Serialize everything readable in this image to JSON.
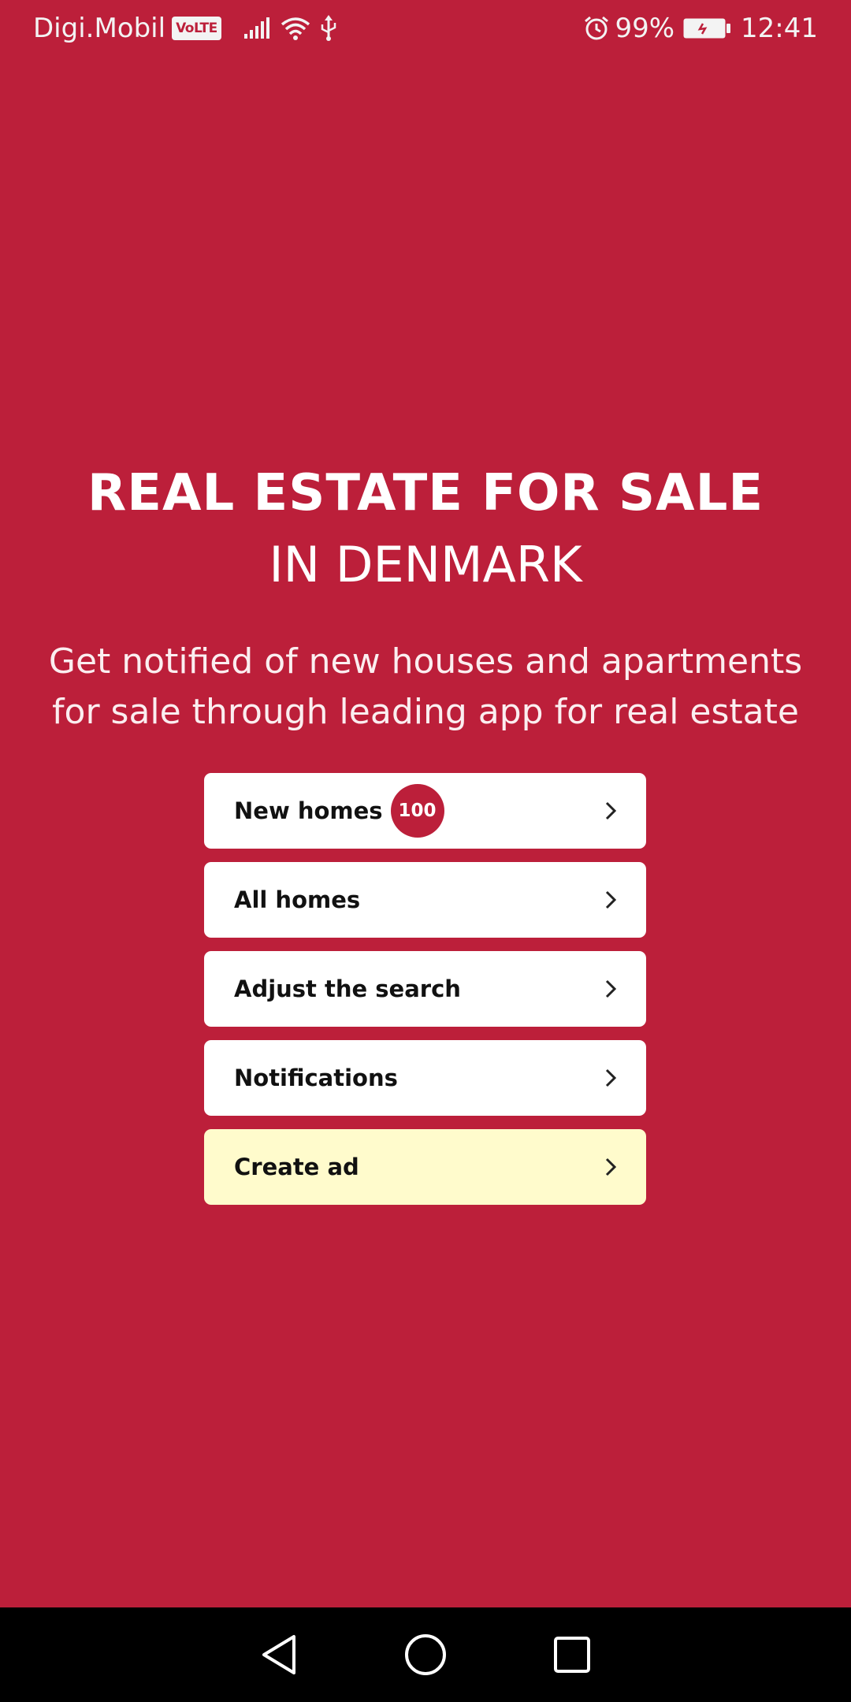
{
  "status_bar": {
    "carrier": "Digi.Mobil",
    "volte": "VoLTE",
    "battery": "99%",
    "time": "12:41",
    "icons": [
      "signal-icon",
      "wifi-icon",
      "usb-icon",
      "alarm-icon",
      "battery-icon"
    ]
  },
  "hero": {
    "title_bold": "REAL ESTATE FOR SALE",
    "title_light": "IN DENMARK",
    "subtitle": "Get notified of new houses and apartments for sale through leading app for real estate"
  },
  "menu": {
    "items": [
      {
        "label": "New homes",
        "badge": "100"
      },
      {
        "label": "All homes"
      },
      {
        "label": "Adjust the search"
      },
      {
        "label": "Notifications"
      },
      {
        "label": "Create ad"
      }
    ]
  },
  "nav_bar": {
    "icons": [
      "back-icon",
      "home-icon",
      "recents-icon"
    ]
  },
  "colors": {
    "background": "#bc1f3a",
    "button": "#ffffff",
    "highlight_button": "#fffbcc",
    "badge": "#bc1f3a",
    "nav_bar": "#000000"
  }
}
